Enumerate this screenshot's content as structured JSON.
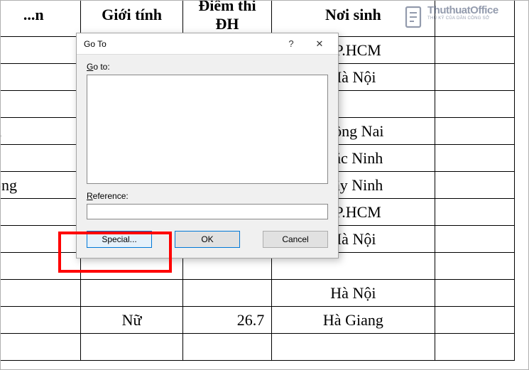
{
  "table": {
    "headers": [
      "...n",
      "Giới tính",
      "Điểm thi ĐH",
      "Nơi sinh",
      ""
    ],
    "rows": [
      [
        "",
        "",
        "",
        "TP.HCM",
        ""
      ],
      [
        "",
        "",
        "",
        "Hà Nội",
        ""
      ],
      [
        "",
        "",
        "",
        "",
        ""
      ],
      [
        "h",
        "",
        "",
        "Đồng Nai",
        ""
      ],
      [
        "",
        "",
        "",
        "Bắc Ninh",
        ""
      ],
      [
        "òng",
        "",
        "",
        "Tây Ninh",
        ""
      ],
      [
        "",
        "",
        "",
        "TP.HCM",
        ""
      ],
      [
        "c",
        "",
        "",
        "Hà Nội",
        ""
      ],
      [
        "",
        "",
        "",
        "",
        ""
      ],
      [
        "",
        "",
        "",
        "Hà Nội",
        ""
      ],
      [
        "",
        "Nữ",
        "26.7",
        "Hà Giang",
        ""
      ],
      [
        "",
        "",
        "",
        "",
        ""
      ]
    ]
  },
  "dialog": {
    "title": "Go To",
    "help_glyph": "?",
    "close_glyph": "✕",
    "goto_label_pre": "G",
    "goto_label_post": "o to:",
    "reference_label_pre": "R",
    "reference_label_post": "eference:",
    "reference_value": "",
    "buttons": {
      "special_pre": "S",
      "special_post": "pecial...",
      "ok": "OK",
      "cancel": "Cancel"
    }
  },
  "watermark": {
    "main": "ThuthuatOffice",
    "sub": "THỦ KỸ CỦA DÂN CÔNG SỞ"
  }
}
